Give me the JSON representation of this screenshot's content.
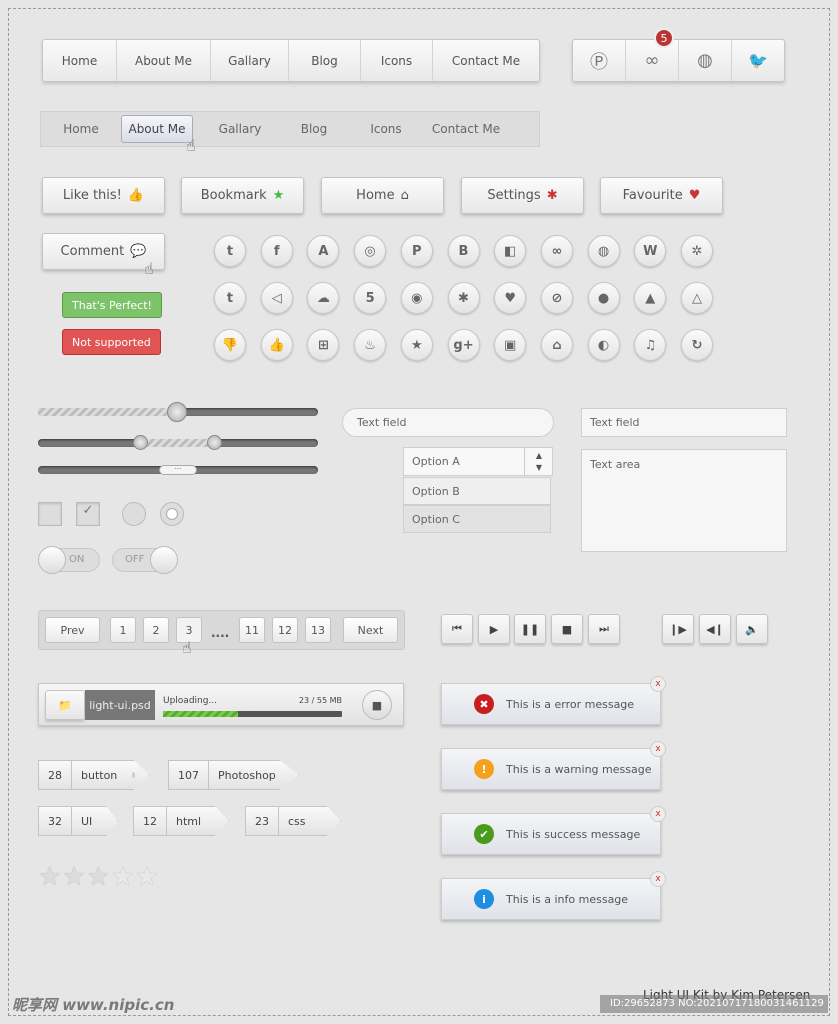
{
  "nav_primary": [
    "Home",
    "About Me",
    "Gallary",
    "Blog",
    "Icons",
    "Contact Me"
  ],
  "nav_secondary": {
    "items": [
      "Home",
      "About Me",
      "Gallary",
      "Blog",
      "Icons",
      "Contact Me"
    ],
    "active": "About Me"
  },
  "social_bar": {
    "icons": [
      "pinterest-icon",
      "stumbleupon-icon",
      "dribbble-icon",
      "twitter-icon"
    ],
    "badge": "5"
  },
  "buttons": [
    "Like this!",
    "Bookmark",
    "Home",
    "Settings",
    "Favourite",
    "Comment"
  ],
  "tooltips": {
    "success": "That's Perfect!",
    "error": "Not supported",
    "success_color": "#7cc36a",
    "error_color": "#e05454"
  },
  "icon_grid": [
    [
      "twitter",
      "facebook",
      "forrst",
      "github",
      "pinterest",
      "blogger",
      "delicious",
      "stumbleupon",
      "dribbble",
      "wordpress",
      "joomla"
    ],
    [
      "tumblr",
      "paper-plane",
      "soundcloud",
      "html5",
      "chrome",
      "settings",
      "heart",
      "compass",
      "chat",
      "vlc",
      "drive"
    ],
    [
      "thumbs-down",
      "thumbs-up",
      "windows",
      "fire",
      "star",
      "google-plus",
      "instagram",
      "home",
      "aperture",
      "music",
      "firefox"
    ]
  ],
  "icon_glyphs": [
    [
      "t",
      "f",
      "A",
      "◎",
      "P",
      "B",
      "◧",
      "∞",
      "◍",
      "W",
      "✲"
    ],
    [
      "t",
      "◁",
      "☁",
      "5",
      "◉",
      "✱",
      "♥",
      "⊘",
      "●",
      "▲",
      "△"
    ],
    [
      "👎",
      "👍",
      "⊞",
      "♨",
      "★",
      "g+",
      "▣",
      "⌂",
      "◐",
      "♫",
      "↻"
    ]
  ],
  "form": {
    "text_field": "Text field",
    "text_field2": "Text field",
    "text_area": "Text area",
    "select_options": [
      "Option A",
      "Option B",
      "Option C"
    ],
    "toggle_on": "ON",
    "toggle_off": "OFF"
  },
  "sliders": {
    "single_value": 0.5,
    "range": [
      0.35,
      0.63
    ],
    "scroll": 0.5
  },
  "pagination": {
    "prev": "Prev",
    "next": "Next",
    "pages": [
      "1",
      "2",
      "3",
      "11",
      "12",
      "13"
    ],
    "current": "3",
    "ellipsis": "...."
  },
  "media_controls": [
    "skip-back",
    "play",
    "pause",
    "stop",
    "skip-forward"
  ],
  "media_controls2": [
    "step-forward",
    "step-back",
    "volume"
  ],
  "upload": {
    "file": "light-ui.psd",
    "status": "Uploading...",
    "size": "23 / 55 MB",
    "progress": 0.42
  },
  "messages": [
    {
      "text": "This is a error message",
      "type": "error",
      "color": "#c81e1e",
      "glyph": "✖"
    },
    {
      "text": "This is a warning message",
      "type": "warning",
      "color": "#f3a21b",
      "glyph": "!"
    },
    {
      "text": "This is success message",
      "type": "success",
      "color": "#4a9a1e",
      "glyph": "✔"
    },
    {
      "text": "This is a info message",
      "type": "info",
      "color": "#1e8ee0",
      "glyph": "i"
    }
  ],
  "close_label": "x",
  "tags": [
    {
      "count": "28",
      "label": "button"
    },
    {
      "count": "107",
      "label": "Photoshop"
    },
    {
      "count": "32",
      "label": "UI"
    },
    {
      "count": "12",
      "label": "html"
    },
    {
      "count": "23",
      "label": "css"
    }
  ],
  "rating": {
    "value": 3,
    "max": 5
  },
  "credit": "Light UI Kit by Kim Petersen",
  "watermark": {
    "logo": "昵享网 www.nipic.cn",
    "id": "ID:29652873 NO:20210717180031461129"
  }
}
